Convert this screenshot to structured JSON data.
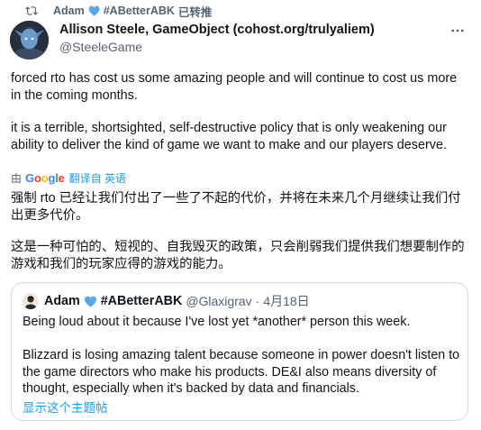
{
  "retweet": {
    "user": "Adam",
    "hashtag": "#ABetterABK",
    "action": "已转推"
  },
  "author": {
    "display_name": "Allison Steele, GameObject (cohost.org/trulyaliem)",
    "handle": "@SteeleGame"
  },
  "tweet": {
    "paragraph1": "forced rto has cost us some amazing people and will continue to cost us more in the coming months.",
    "paragraph2": "it is a terrible, shortsighted, self-destructive policy that is only weakening our ability to deliver the kind of game we want to make and our players deserve."
  },
  "translation": {
    "by": "由",
    "provider": "Google",
    "link_label": "翻译自 英语",
    "paragraph1": "强制 rto 已经让我们付出了一些了不起的代价，并将在未来几个月继续让我们付出更多代价。",
    "paragraph2": "这是一种可怕的、短视的、自我毁灭的政策，只会削弱我们提供我们想要制作的游戏和我们的玩家应得的游戏的能力。"
  },
  "quote": {
    "display_name": "Adam",
    "hashtag": "#ABetterABK",
    "handle": "@Glaxigrav",
    "dot": "·",
    "date": "4月18日",
    "paragraph1": "Being loud about it because I've lost yet *another* person this week.",
    "paragraph2": "Blizzard is losing amazing talent because someone in power doesn't listen to the game directors who make his products. DE&I also means diversity of thought, especially when it's backed by data and financials.",
    "show_thread": "显示这个主题帖"
  },
  "colors": {
    "link_blue": "#1d9bf0",
    "secondary_text": "#536471",
    "heart_blue": "#5aa9e6",
    "border": "#cfd9de"
  }
}
